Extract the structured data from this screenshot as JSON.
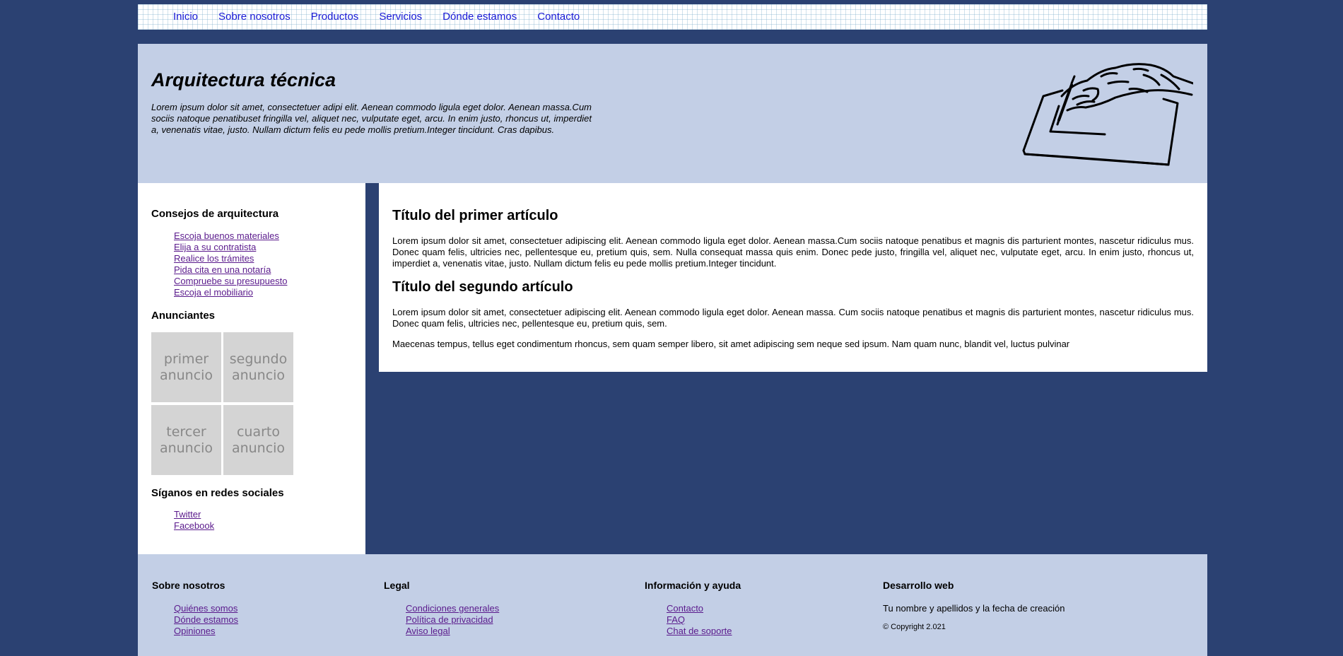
{
  "nav": {
    "items": [
      "Inicio",
      "Sobre nosotros",
      "Productos",
      "Servicios",
      "Dónde estamos",
      "Contacto"
    ]
  },
  "header": {
    "title": "Arquitectura técnica",
    "text": "Lorem ipsum dolor sit amet, consectetuer adipi elit. Aenean commodo ligula eget dolor. Aenean massa.Cum sociis natoque penatibuset fringilla vel, aliquet nec, vulputate eget, arcu. In enim justo, rhoncus ut, imperdiet a, venenatis vitae, justo. Nullam dictum felis eu pede mollis pretium.Integer tincidunt. Cras dapibus."
  },
  "sidebar": {
    "tips_title": "Consejos de arquitectura",
    "tips": [
      "Escoja buenos materiales",
      "Elija a su contratista",
      "Realice los trámites",
      "Pida cita en una notaría",
      "Compruebe su presupuesto",
      "Escoja el mobiliario"
    ],
    "ads_title": "Anunciantes",
    "ads": [
      "primer anuncio",
      "segundo anuncio",
      "tercer anuncio",
      "cuarto anuncio"
    ],
    "social_title": "Síganos en redes sociales",
    "social": [
      "Twitter",
      "Facebook"
    ]
  },
  "main": {
    "article1_title": "Título del primer artículo",
    "article1_text": "Lorem ipsum dolor sit amet, consectetuer adipiscing elit. Aenean commodo ligula eget dolor. Aenean massa.Cum sociis natoque penatibus et magnis dis parturient montes, nascetur ridiculus mus. Donec quam felis, ultricies nec, pellentesque eu, pretium quis, sem. Nulla consequat massa quis enim. Donec pede justo, fringilla vel, aliquet nec, vulputate eget, arcu. In enim justo, rhoncus ut, imperdiet a, venenatis vitae, justo. Nullam dictum felis eu pede mollis pretium.Integer tincidunt.",
    "article2_title": "Título del segundo artículo",
    "article2_text1": "Lorem ipsum dolor sit amet, consectetuer adipiscing elit. Aenean commodo ligula eget dolor. Aenean massa. Cum sociis natoque penatibus et magnis dis parturient montes, nascetur ridiculus mus. Donec quam felis, ultricies nec, pellentesque eu, pretium quis, sem.",
    "article2_text2": "Maecenas tempus, tellus eget condimentum rhoncus, sem quam semper libero, sit amet adipiscing sem neque sed ipsum. Nam quam nunc, blandit vel, luctus pulvinar"
  },
  "footer": {
    "about_title": "Sobre nosotros",
    "about_links": [
      "Quiénes somos",
      "Dónde estamos",
      "Opiniones"
    ],
    "legal_title": "Legal",
    "legal_links": [
      "Condiciones generales",
      "Política de privacidad",
      "Aviso legal"
    ],
    "help_title": "Información y ayuda",
    "help_links": [
      "Contacto",
      "FAQ",
      "Chat de soporte"
    ],
    "dev_title": "Desarrollo web",
    "dev_text": "Tu nombre y apellidos y la fecha de creación",
    "copyright": "© Copyright 2.021"
  },
  "colors": {
    "background": "#2b4172",
    "header_bg": "#c3cfe6",
    "nav_link": "#1a1ad6",
    "visited_link": "#5a1a8c",
    "ad_bg": "#d4d4d4"
  },
  "icons": [
    "drawing-hand-illustration"
  ]
}
